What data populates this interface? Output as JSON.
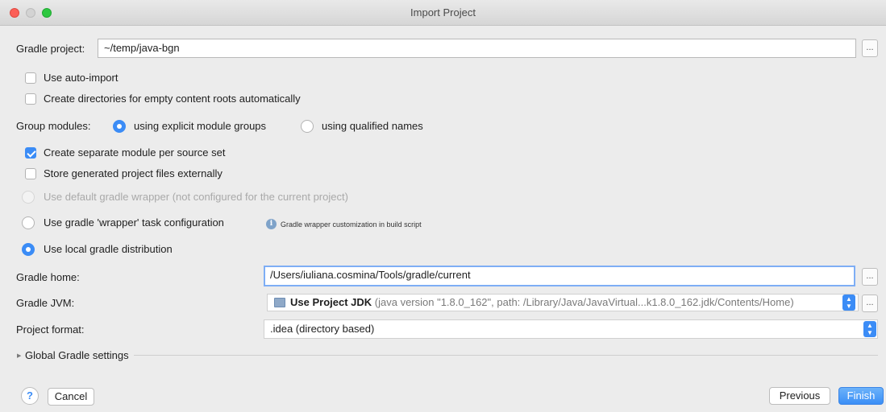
{
  "window": {
    "title": "Import Project"
  },
  "gradle_project": {
    "label": "Gradle project:",
    "value": "~/temp/java-bgn",
    "browse": "..."
  },
  "options": {
    "auto_import": {
      "label": "Use auto-import",
      "checked": false
    },
    "create_dirs": {
      "label": "Create directories for empty content roots automatically",
      "checked": false
    }
  },
  "group_modules": {
    "label": "Group modules:",
    "explicit": "using explicit module groups",
    "qualified": "using qualified names",
    "selected": "explicit"
  },
  "module_options": {
    "separate_module": {
      "label": "Create separate module per source set",
      "checked": true
    },
    "store_external": {
      "label": "Store generated project files externally",
      "checked": false
    }
  },
  "distribution": {
    "default_wrapper": "Use default gradle wrapper (not configured for the current project)",
    "wrapper_task": "Use gradle 'wrapper' task configuration",
    "wrapper_hint": "Gradle wrapper customization in build script",
    "local": "Use local gradle distribution",
    "selected": "local"
  },
  "gradle_home": {
    "label": "Gradle home:",
    "value": "/Users/iuliana.cosmina/Tools/gradle/current",
    "browse": "..."
  },
  "gradle_jvm": {
    "label": "Gradle JVM:",
    "value_main": "Use Project JDK",
    "value_detail": "(java version \"1.8.0_162\", path: /Library/Java/JavaVirtual...k1.8.0_162.jdk/Contents/Home)",
    "browse": "..."
  },
  "project_format": {
    "label": "Project format:",
    "value": ".idea (directory based)"
  },
  "global_settings": {
    "label": "Global Gradle settings"
  },
  "footer": {
    "help": "?",
    "cancel": "Cancel",
    "previous": "Previous",
    "finish": "Finish"
  },
  "colors": {
    "accent": "#3b8cf6",
    "focus": "#7eaef5"
  }
}
